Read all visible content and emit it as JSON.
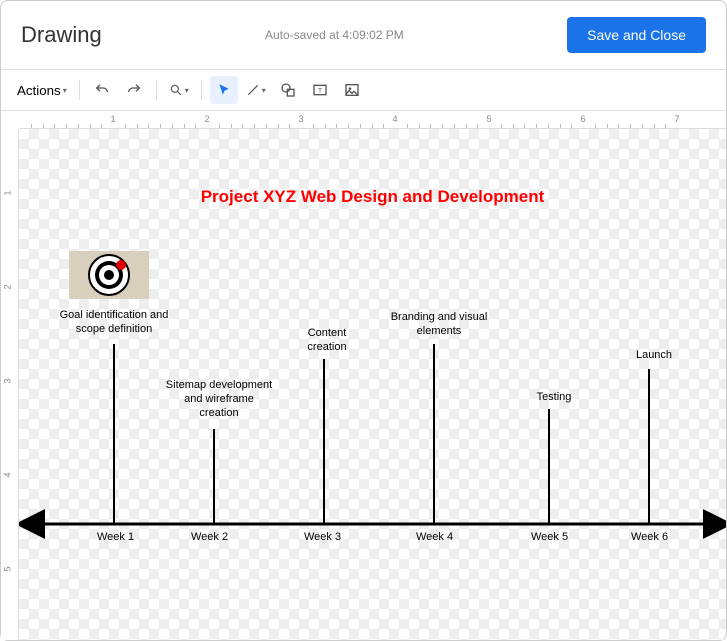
{
  "header": {
    "title": "Drawing",
    "autosave": "Auto-saved at 4:09:02 PM",
    "save_label": "Save and Close"
  },
  "toolbar": {
    "actions_label": "Actions"
  },
  "ruler": {
    "h": [
      "1",
      "2",
      "3",
      "4",
      "5",
      "6",
      "7"
    ],
    "v": [
      "1",
      "2",
      "3",
      "4",
      "5"
    ]
  },
  "chart_data": {
    "type": "timeline",
    "title": "Project XYZ Web Design and Development",
    "axis_labels": [
      "Week 1",
      "Week 2",
      "Week 3",
      "Week 4",
      "Week 5",
      "Week 6"
    ],
    "milestones": [
      {
        "week": 1,
        "label": "Goal identification and scope definition"
      },
      {
        "week": 2,
        "label": "Sitemap development and wireframe creation"
      },
      {
        "week": 3,
        "label": "Content creation"
      },
      {
        "week": 4,
        "label": "Branding and visual elements"
      },
      {
        "week": 5,
        "label": "Testing"
      },
      {
        "week": 6,
        "label": "Launch"
      }
    ]
  }
}
